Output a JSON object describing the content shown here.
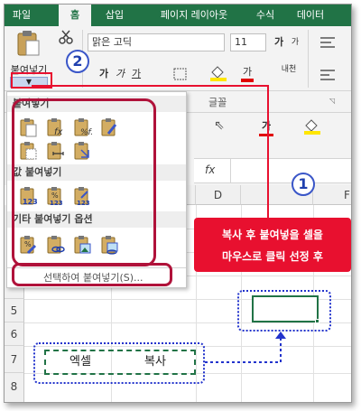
{
  "tabs": [
    "파일",
    "홈",
    "삽입",
    "페이지 레이아웃",
    "수식",
    "데이터"
  ],
  "active_tab": "홈",
  "ribbon": {
    "paste_label": "붙여넣기",
    "font_name": "맑은 고딕",
    "font_size": "11",
    "font_grow": "가",
    "font_shrink": "가",
    "bold": "가",
    "italic": "가",
    "underline": "가",
    "phonetic": "내천",
    "group_font": "글꼴",
    "toolbar_font_color": "가"
  },
  "paste_menu": {
    "section_paste": "붙여넣기",
    "section_values": "값 붙여넣기",
    "section_other": "기타 붙여넣기 옵션",
    "footer": "선택하여 붙여넣기(S)..."
  },
  "formula_bar": {
    "fx": "fx",
    "check": "✓"
  },
  "grid": {
    "columns": [
      "D",
      "F"
    ],
    "rows": [
      "5",
      "6",
      "7",
      "8"
    ],
    "cell_b7": "엑셀",
    "cell_c7": "복사"
  },
  "callout": {
    "line1": "복사 후 붙여넣을 셀을",
    "line2": "마우스로 클릭 선정 후"
  },
  "markers": {
    "one": "1",
    "two": "2"
  },
  "colors": {
    "excel_green": "#217346",
    "accent_red": "#e8102f",
    "outline_red": "#b0123a",
    "marker_blue": "#3a56c8"
  }
}
